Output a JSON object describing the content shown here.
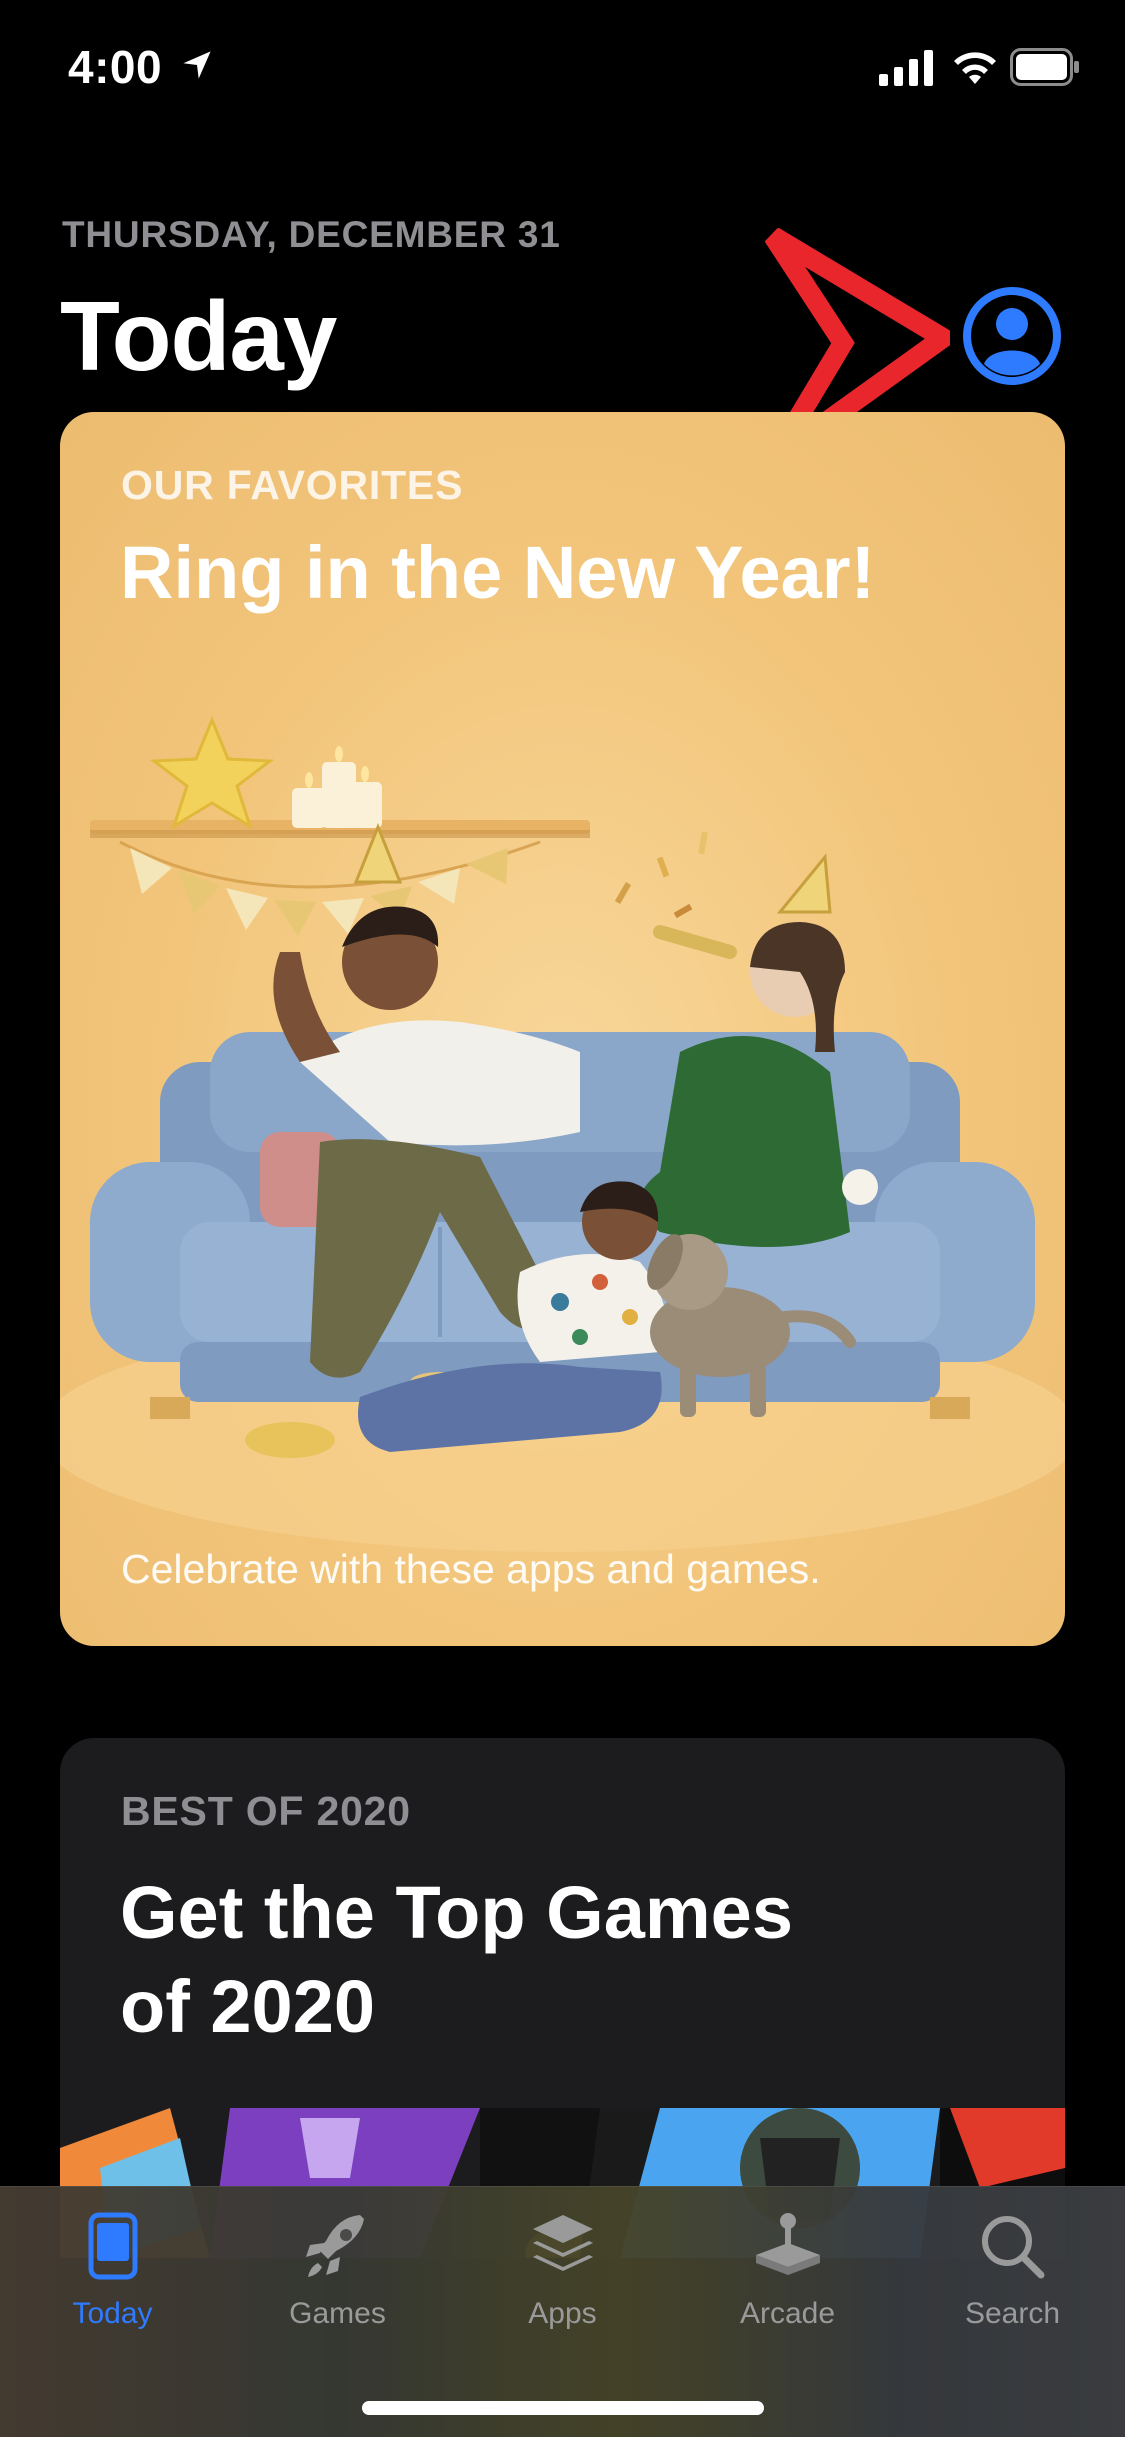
{
  "status_bar": {
    "time": "4:00"
  },
  "header": {
    "date": "THURSDAY, DECEMBER 31",
    "title": "Today"
  },
  "cards": [
    {
      "eyebrow": "OUR FAVORITES",
      "title": "Ring in the New Year!",
      "caption": "Celebrate with these apps and games."
    },
    {
      "eyebrow": "BEST OF 2020",
      "title": "Get the Top Games of 2020"
    }
  ],
  "tab_bar": {
    "tabs": [
      {
        "label": "Today",
        "icon": "today-icon",
        "active": true
      },
      {
        "label": "Games",
        "icon": "rocket-icon",
        "active": false
      },
      {
        "label": "Apps",
        "icon": "layers-icon",
        "active": false
      },
      {
        "label": "Arcade",
        "icon": "joystick-icon",
        "active": false
      },
      {
        "label": "Search",
        "icon": "search-icon",
        "active": false
      }
    ]
  },
  "colors": {
    "accent": "#2f7bff",
    "annotation_arrow": "#e8262c",
    "card_background": "#f2c57b",
    "inactive_tab": "#9a9a9a"
  }
}
